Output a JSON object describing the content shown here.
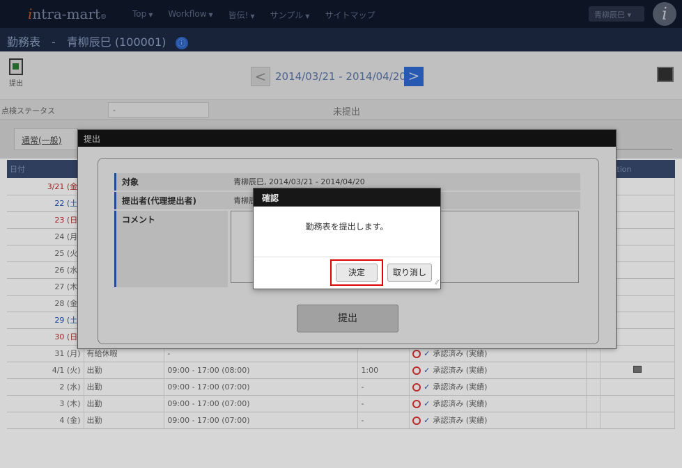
{
  "app": {
    "logo_prefix": "i",
    "logo_rest": "ntra-mart",
    "logo_mark": "®",
    "badge_letter": "i"
  },
  "nav": {
    "items": [
      "Top",
      "Workflow",
      "皆伝!",
      "サンプル",
      "サイトマップ"
    ],
    "user_label": "青柳辰巳"
  },
  "page": {
    "title": "勤務表　-　青柳辰巳 (100001)",
    "info_icon": "ⓘ"
  },
  "toolbar": {
    "submit_label": "提出",
    "prev_glyph": "<",
    "next_glyph": ">",
    "period": "2014/03/21 - 2014/04/20"
  },
  "status": {
    "label": "点検ステータス",
    "value": "-",
    "state": "未提出"
  },
  "tab": {
    "label": "通常(一般)"
  },
  "grid": {
    "col_date": "日付",
    "col_caution": "caution",
    "rows": [
      {
        "date": "3/21 (金)",
        "kind": "sun",
        "type": "",
        "time": "",
        "extra": "",
        "status": ""
      },
      {
        "date": "22 (土)",
        "kind": "sat",
        "type": "",
        "time": "",
        "extra": "",
        "status": ""
      },
      {
        "date": "23 (日)",
        "kind": "sun",
        "type": "",
        "time": "",
        "extra": "",
        "status": ""
      },
      {
        "date": "24 (月)",
        "kind": "",
        "type": "",
        "time": "",
        "extra": "",
        "status": ""
      },
      {
        "date": "25 (火)",
        "kind": "",
        "type": "",
        "time": "",
        "extra": "",
        "status": ""
      },
      {
        "date": "26 (水)",
        "kind": "",
        "type": "",
        "time": "",
        "extra": "",
        "status": ""
      },
      {
        "date": "27 (木)",
        "kind": "",
        "type": "",
        "time": "",
        "extra": "",
        "status": ""
      },
      {
        "date": "28 (金)",
        "kind": "",
        "type": "",
        "time": "",
        "extra": "",
        "status": ""
      },
      {
        "date": "29 (土)",
        "kind": "sat",
        "type": "",
        "time": "",
        "extra": "",
        "status": ""
      },
      {
        "date": "30 (日)",
        "kind": "sun",
        "type": "",
        "time": "",
        "extra": "",
        "status": ""
      },
      {
        "date": "31 (月)",
        "kind": "",
        "type": "有給休暇",
        "time": "-",
        "extra": "",
        "status": "承認済み (実績)"
      },
      {
        "date": "4/1 (火)",
        "kind": "",
        "type": "出勤",
        "time": "09:00 - 17:00 (08:00)",
        "extra": "1:00",
        "status": "承認済み (実績)"
      },
      {
        "date": "2 (水)",
        "kind": "",
        "type": "出勤",
        "time": "09:00 - 17:00 (07:00)",
        "extra": "-",
        "status": "承認済み (実績)"
      },
      {
        "date": "3 (木)",
        "kind": "",
        "type": "出勤",
        "time": "09:00 - 17:00 (07:00)",
        "extra": "-",
        "status": "承認済み (実績)"
      },
      {
        "date": "4 (金)",
        "kind": "",
        "type": "出勤",
        "time": "09:00 - 17:00 (07:00)",
        "extra": "-",
        "status": "承認済み (実績)"
      }
    ]
  },
  "dialog": {
    "title": "提出",
    "target_label": "対象",
    "target_value": "青柳辰巳, 2014/03/21 - 2014/04/20",
    "submitter_label": "提出者(代理提出者)",
    "submitter_value": "青柳辰",
    "comment_label": "コメント",
    "submit_button": "提出"
  },
  "confirm": {
    "title": "確認",
    "message": "勤務表を提出します。",
    "ok_label": "決定",
    "cancel_label": "取り消し"
  }
}
